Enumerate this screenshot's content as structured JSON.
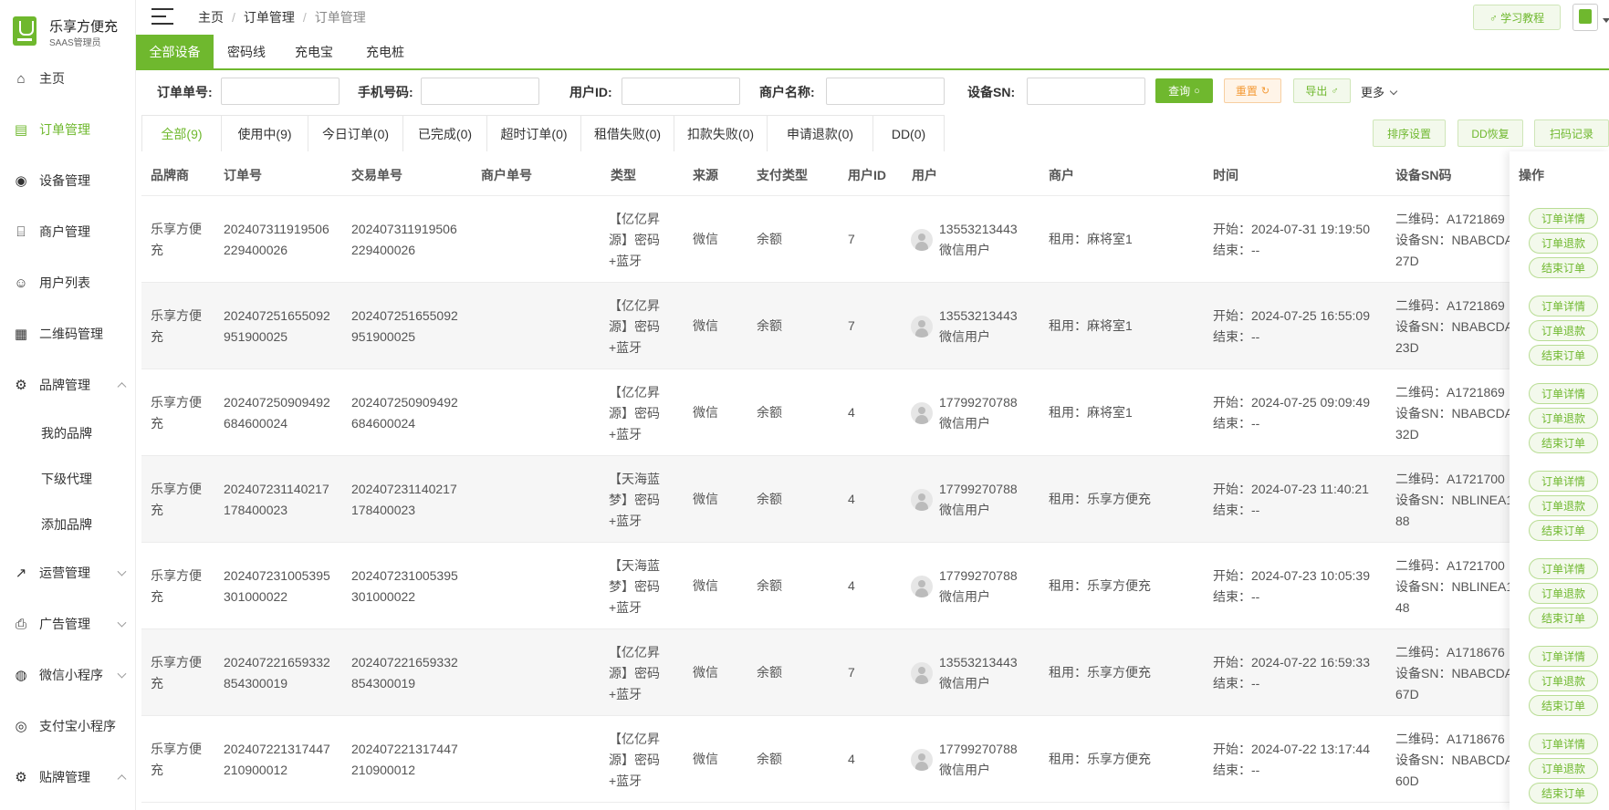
{
  "brand": {
    "name": "乐享方便充",
    "role": "SAAS管理员"
  },
  "sidebar": {
    "items": [
      {
        "label": "主页",
        "icon": "home-icon"
      },
      {
        "label": "订单管理",
        "icon": "order-icon"
      },
      {
        "label": "设备管理",
        "icon": "device-icon"
      },
      {
        "label": "商户管理",
        "icon": "merchant-icon"
      },
      {
        "label": "用户列表",
        "icon": "user-icon"
      },
      {
        "label": "二维码管理",
        "icon": "qrcode-icon"
      },
      {
        "label": "品牌管理",
        "icon": "brand-icon"
      },
      {
        "label": "我的品牌"
      },
      {
        "label": "下级代理"
      },
      {
        "label": "添加品牌"
      },
      {
        "label": "运营管理",
        "icon": "operation-icon"
      },
      {
        "label": "广告管理",
        "icon": "ad-icon"
      },
      {
        "label": "微信小程序",
        "icon": "wechat-icon"
      },
      {
        "label": "支付宝小程序",
        "icon": "alipay-icon"
      },
      {
        "label": "贴牌管理",
        "icon": "settings-icon"
      }
    ]
  },
  "topbar": {
    "breadcrumb": [
      "主页",
      "订单管理",
      "订单管理"
    ],
    "tutorial_label": "♂ 学习教程"
  },
  "device_tabs": [
    "全部设备",
    "密码线",
    "充电宝",
    "充电桩"
  ],
  "filters": {
    "order_no": "订单单号:",
    "phone": "手机号码:",
    "user_id": "用户ID:",
    "merchant_name": "商户名称:",
    "device_sn": "设备SN:",
    "query": "查询",
    "reset": "重置",
    "export": "导出",
    "more": "更多"
  },
  "status_tabs": [
    "全部(9)",
    "使用中(9)",
    "今日订单(0)",
    "已完成(0)",
    "超时订单(0)",
    "租借失败(0)",
    "扣款失败(0)",
    "申请退款(0)",
    "DD(0)"
  ],
  "tools": [
    "排序设置",
    "DD恢复",
    "扫码记录"
  ],
  "columns": {
    "brand": "品牌商",
    "order_no": "订单号",
    "trade_no": "交易单号",
    "merchant_no": "商户单号",
    "type": "类型",
    "source": "来源",
    "pay_type": "支付类型",
    "user_id": "用户ID",
    "user": "用户",
    "merchant": "商户",
    "time": "时间",
    "sn": "设备SN码",
    "actions": "操作"
  },
  "action_labels": {
    "detail": "订单详情",
    "refund": "订单退款",
    "end": "结束订单"
  },
  "rows": [
    {
      "brand": "乐享方便充",
      "order_no": "202407311919506229400026",
      "trade_no": "202407311919506229400026",
      "type": "【亿亿昇源】密码+蓝牙",
      "source": "微信",
      "pay_type": "余额",
      "user_id": "7",
      "phone": "13553213443",
      "user_type": "微信用户",
      "merchant": "租用：麻将室1",
      "start": "开始：2024-07-31 19:19:50",
      "end": "结束：--",
      "qr": "二维码：A1721869",
      "sn": "设备SN：NBABCDA",
      "sn_tail": "27D"
    },
    {
      "brand": "乐享方便充",
      "order_no": "202407251655092951900025",
      "trade_no": "202407251655092951900025",
      "type": "【亿亿昇源】密码+蓝牙",
      "source": "微信",
      "pay_type": "余额",
      "user_id": "7",
      "phone": "13553213443",
      "user_type": "微信用户",
      "merchant": "租用：麻将室1",
      "start": "开始：2024-07-25 16:55:09",
      "end": "结束：--",
      "qr": "二维码：A1721869",
      "sn": "设备SN：NBABCDA",
      "sn_tail": "23D"
    },
    {
      "brand": "乐享方便充",
      "order_no": "202407250909492684600024",
      "trade_no": "202407250909492684600024",
      "type": "【亿亿昇源】密码+蓝牙",
      "source": "微信",
      "pay_type": "余额",
      "user_id": "4",
      "phone": "17799270788",
      "user_type": "微信用户",
      "merchant": "租用：麻将室1",
      "start": "开始：2024-07-25 09:09:49",
      "end": "结束：--",
      "qr": "二维码：A1721869",
      "sn": "设备SN：NBABCDA",
      "sn_tail": "32D"
    },
    {
      "brand": "乐享方便充",
      "order_no": "202407231140217178400023",
      "trade_no": "202407231140217178400023",
      "type": "【天海蓝梦】密码+蓝牙",
      "source": "微信",
      "pay_type": "余额",
      "user_id": "4",
      "phone": "17799270788",
      "user_type": "微信用户",
      "merchant": "租用：乐享方便充",
      "start": "开始：2024-07-23 11:40:21",
      "end": "结束：--",
      "qr": "二维码：A1721700",
      "sn": "设备SN：NBLINEA1",
      "sn_tail": "88"
    },
    {
      "brand": "乐享方便充",
      "order_no": "202407231005395301000022",
      "trade_no": "202407231005395301000022",
      "type": "【天海蓝梦】密码+蓝牙",
      "source": "微信",
      "pay_type": "余额",
      "user_id": "4",
      "phone": "17799270788",
      "user_type": "微信用户",
      "merchant": "租用：乐享方便充",
      "start": "开始：2024-07-23 10:05:39",
      "end": "结束：--",
      "qr": "二维码：A1721700",
      "sn": "设备SN：NBLINEA1",
      "sn_tail": "48"
    },
    {
      "brand": "乐享方便充",
      "order_no": "202407221659332854300019",
      "trade_no": "202407221659332854300019",
      "type": "【亿亿昇源】密码+蓝牙",
      "source": "微信",
      "pay_type": "余额",
      "user_id": "7",
      "phone": "13553213443",
      "user_type": "微信用户",
      "merchant": "租用：乐享方便充",
      "start": "开始：2024-07-22 16:59:33",
      "end": "结束：--",
      "qr": "二维码：A1718676",
      "sn": "设备SN：NBABCDA",
      "sn_tail": "67D"
    },
    {
      "brand": "乐享方便充",
      "order_no": "202407221317447210900012",
      "trade_no": "202407221317447210900012",
      "type": "【亿亿昇源】密码+蓝牙",
      "source": "微信",
      "pay_type": "余额",
      "user_id": "4",
      "phone": "17799270788",
      "user_type": "微信用户",
      "merchant": "租用：乐享方便充",
      "start": "开始：2024-07-22 13:17:44",
      "end": "结束：--",
      "qr": "二维码：A1718676",
      "sn": "设备SN：NBABCDA",
      "sn_tail": "60D"
    }
  ],
  "colors": {
    "accent": "#6fb82e",
    "warning": "#f39a36"
  }
}
